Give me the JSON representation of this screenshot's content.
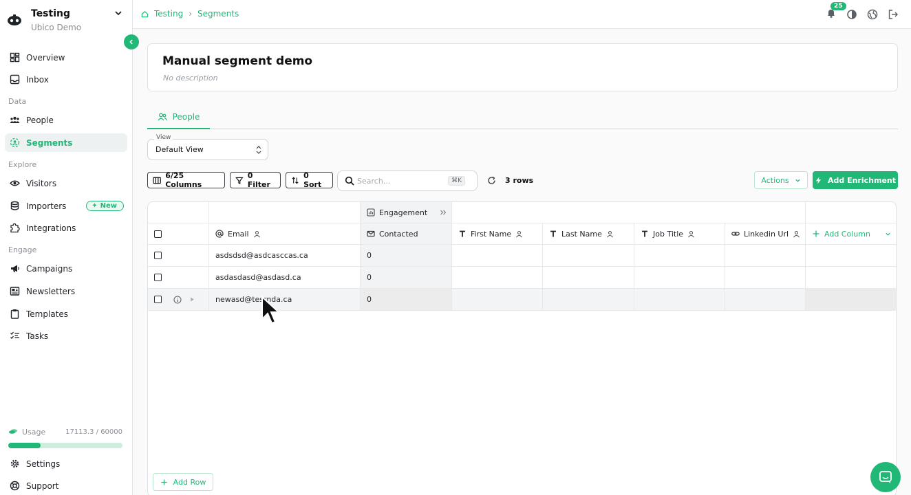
{
  "workspace": {
    "name": "Testing",
    "subtitle": "Ubico Demo"
  },
  "sidebar": {
    "items_top": [
      {
        "label": "Overview",
        "icon": "dashboard-icon"
      },
      {
        "label": "Inbox",
        "icon": "inbox-icon"
      }
    ],
    "section_data": "Data",
    "items_data": [
      {
        "label": "People",
        "icon": "people-icon"
      },
      {
        "label": "Segments",
        "icon": "segments-icon",
        "active": true
      }
    ],
    "section_explore": "Explore",
    "items_explore": [
      {
        "label": "Visitors",
        "icon": "eye-icon"
      },
      {
        "label": "Importers",
        "icon": "importers-icon",
        "badge": "New"
      },
      {
        "label": "Integrations",
        "icon": "puzzle-icon"
      }
    ],
    "section_engage": "Engage",
    "items_engage": [
      {
        "label": "Campaigns",
        "icon": "megaphone-icon"
      },
      {
        "label": "Newsletters",
        "icon": "newspaper-icon"
      },
      {
        "label": "Templates",
        "icon": "clipboard-icon"
      },
      {
        "label": "Tasks",
        "icon": "tasks-icon"
      }
    ],
    "usage": {
      "label": "Usage",
      "value": "17113.3 / 60000",
      "fraction": 0.285
    },
    "items_bottom": [
      {
        "label": "Settings",
        "icon": "gear-icon"
      },
      {
        "label": "Support",
        "icon": "lifebuoy-icon"
      }
    ]
  },
  "topbar": {
    "breadcrumb": [
      "Testing",
      "Segments"
    ],
    "notifications": "25"
  },
  "page": {
    "title": "Manual segment demo",
    "description": "No description",
    "tab": "People",
    "view_label": "View",
    "view_value": "Default View"
  },
  "toolbar": {
    "columns": "6/25 Columns",
    "filter": "0 Filter",
    "sort": "0 Sort",
    "search_placeholder": "Search...",
    "search_shortcut": "⌘K",
    "rows": "3 rows",
    "actions": "Actions",
    "add_enrichment": "Add Enrichment"
  },
  "table": {
    "group_header": "Engagement",
    "columns": [
      "Email",
      "Contacted",
      "First Name",
      "Last Name",
      "Job Title",
      "Linkedin Url"
    ],
    "add_column": "Add Column",
    "rows": [
      {
        "email": "asdsdsd@asdcasccas.ca",
        "contacted": "0"
      },
      {
        "email": "asdasdasd@asdasd.ca",
        "contacted": "0"
      },
      {
        "email": "newasd@tesrnda.ca",
        "contacted": "0"
      }
    ],
    "add_row": "Add Row"
  },
  "colors": {
    "accent": "#21b877",
    "border": "#dfe2e5"
  }
}
